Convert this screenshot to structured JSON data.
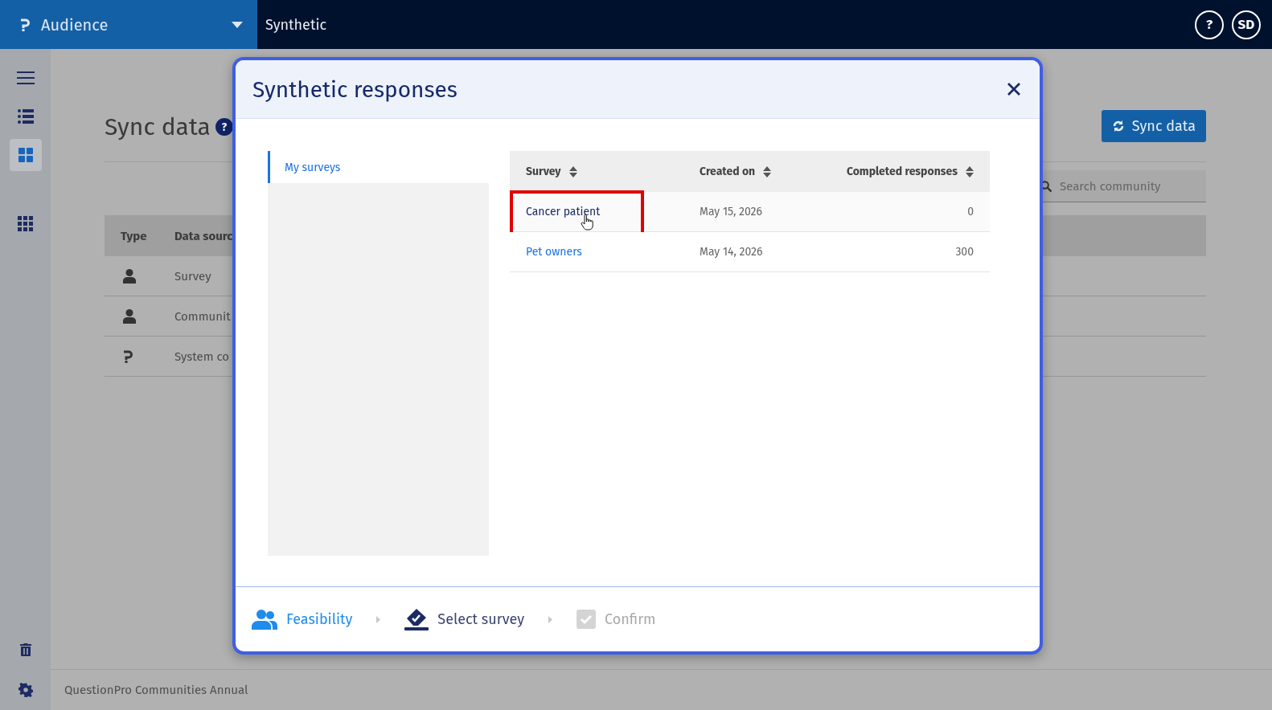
{
  "topbar": {
    "brand": "Audience",
    "section": "Synthetic",
    "help": "?",
    "avatar": "SD"
  },
  "sidebar": {
    "items": [
      {
        "selected": false
      },
      {
        "selected": false
      },
      {
        "selected": true
      },
      {
        "selected": false
      }
    ]
  },
  "page": {
    "title": "Sync data",
    "help": "?",
    "sync_button": "Sync data",
    "search": {
      "placeholder": "Search community"
    },
    "table": {
      "columns": [
        "Type",
        "Data sourc"
      ],
      "rows": [
        {
          "kind": "person",
          "source": "Survey"
        },
        {
          "kind": "person",
          "source": "Communit"
        },
        {
          "kind": "logo",
          "source": "System co"
        }
      ]
    },
    "footer": "QuestionPro Communities Annual"
  },
  "modal": {
    "title": "Synthetic responses",
    "nav": [
      {
        "label": "My surveys",
        "selected": true
      }
    ],
    "table": {
      "columns": [
        "Survey",
        "Created on",
        "Completed responses"
      ],
      "rows": [
        {
          "survey": "Cancer patient",
          "created_on": "May 15, 2026",
          "completed": "0",
          "hovered": true,
          "highlighted": true
        },
        {
          "survey": "Pet owners",
          "created_on": "May 14, 2026",
          "completed": "300",
          "hovered": false,
          "highlighted": false
        }
      ]
    },
    "steps": [
      {
        "label": "Feasibility",
        "completed": true,
        "current": false
      },
      {
        "label": "Select survey",
        "completed": false,
        "current": true
      },
      {
        "label": "Confirm",
        "completed": false,
        "current": false
      }
    ]
  }
}
